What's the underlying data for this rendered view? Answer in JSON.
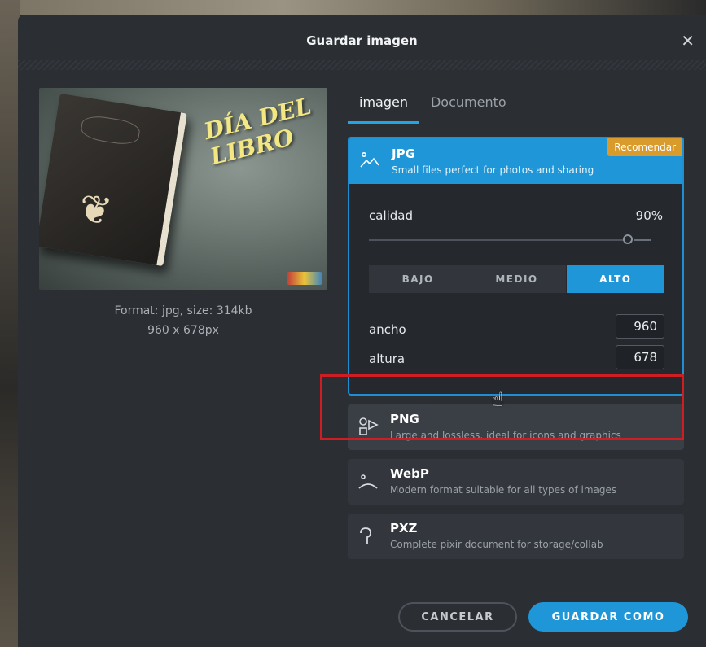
{
  "dialog": {
    "title": "Guardar imagen",
    "close_symbol": "✕"
  },
  "preview": {
    "image_title": "DÍA DEL LIBRO",
    "format_info": "Format: jpg, size: 314kb",
    "dimensions": "960 x 678px"
  },
  "tabs": [
    {
      "label": "imagen",
      "active": true
    },
    {
      "label": "Documento",
      "active": false
    }
  ],
  "formats": {
    "jpg": {
      "name": "JPG",
      "description": "Small files perfect for photos and sharing",
      "badge": "Recomendar",
      "icon": "photo-icon",
      "quality_label": "calidad",
      "quality_value": "90%",
      "quality_fraction": 0.9,
      "quality_presets": [
        "BAJO",
        "MEDIO",
        "ALTO"
      ],
      "active_preset": "ALTO",
      "width_label": "ancho",
      "width_value": "960",
      "height_label": "altura",
      "height_value": "678"
    },
    "png": {
      "name": "PNG",
      "description": "Large and lossless, ideal for icons and graphics",
      "icon": "shapes-icon"
    },
    "webp": {
      "name": "WebP",
      "description": "Modern format suitable for all types of images",
      "icon": "webp-icon"
    },
    "pxz": {
      "name": "PXZ",
      "description": "Complete pixir document for storage/collab",
      "icon": "pin-icon"
    }
  },
  "buttons": {
    "cancel": "CANCELAR",
    "save": "GUARDAR COMO"
  },
  "colors": {
    "accent": "#1f96d8",
    "badge": "#d99b2b",
    "highlight": "#cf1d24"
  }
}
